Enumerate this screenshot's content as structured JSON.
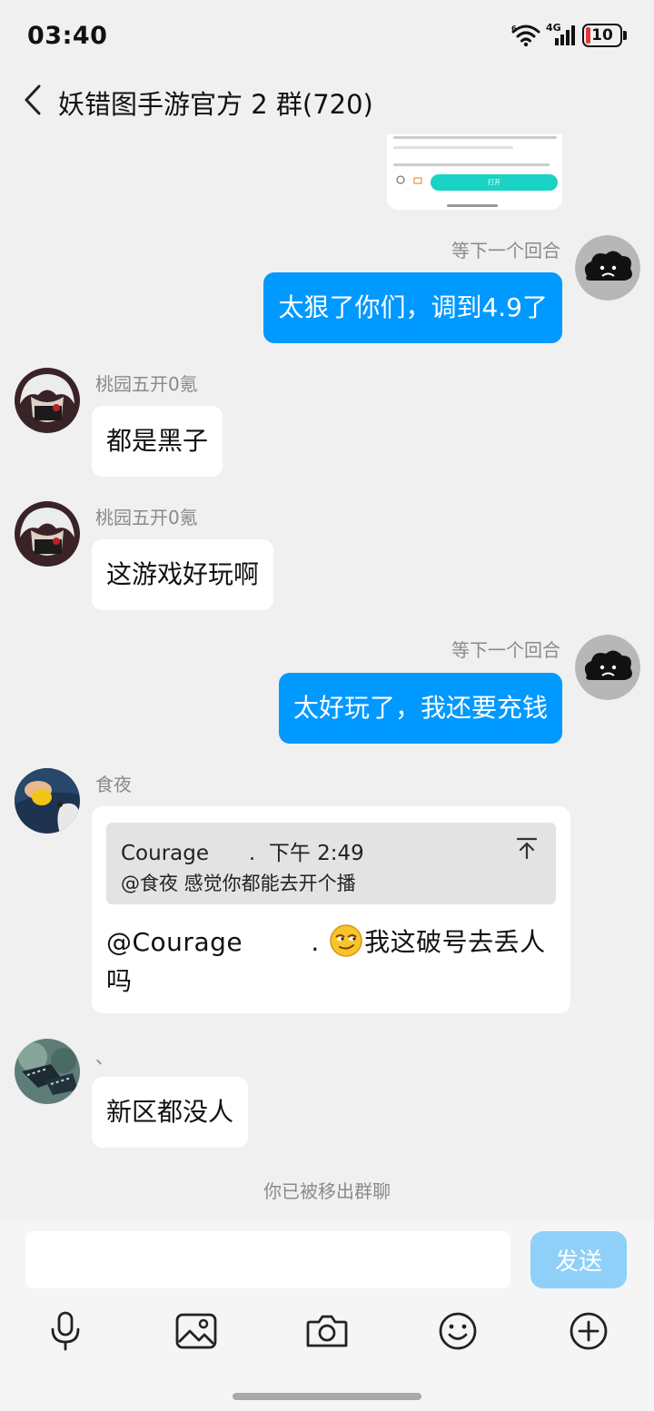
{
  "status_bar": {
    "time": "03:40",
    "network": "4G",
    "battery": "10"
  },
  "header": {
    "title": "妖错图手游官方 2 群(720)"
  },
  "card_preview": {
    "open_label": "打开"
  },
  "messages": [
    {
      "sender": "等下一个回合",
      "text": "太狠了你们，调到4.9了",
      "direction": "out"
    },
    {
      "sender": "桃园五开0氪",
      "text": "都是黑子",
      "direction": "in"
    },
    {
      "sender": "桃园五开0氪",
      "text": "这游戏好玩啊",
      "direction": "in"
    },
    {
      "sender": "等下一个回合",
      "text": "太好玩了，我还要充钱",
      "direction": "out"
    },
    {
      "sender": "食夜",
      "direction": "in",
      "quote": {
        "author": "Courage",
        "author_suffix": ".",
        "time": "下午 2:49",
        "text": "@食夜 感觉你都能去开个播"
      },
      "text_line1_prefix": "@Courage",
      "text_line1_dot": ".",
      "text_line1_suffix": "我这破号去丢人",
      "text_line2": "吗"
    },
    {
      "sender": "、",
      "text": "新区都没人",
      "direction": "in"
    }
  ],
  "system_message": "你已被移出群聊",
  "input": {
    "value": "",
    "placeholder": ""
  },
  "send_label": "发送",
  "toolbar_icons": [
    "microphone-icon",
    "image-icon",
    "camera-icon",
    "emoji-icon",
    "plus-icon"
  ],
  "colors": {
    "outgoing_bubble": "#0099ff",
    "send_button": "#8fd0f8",
    "background": "#f0f0f0"
  }
}
